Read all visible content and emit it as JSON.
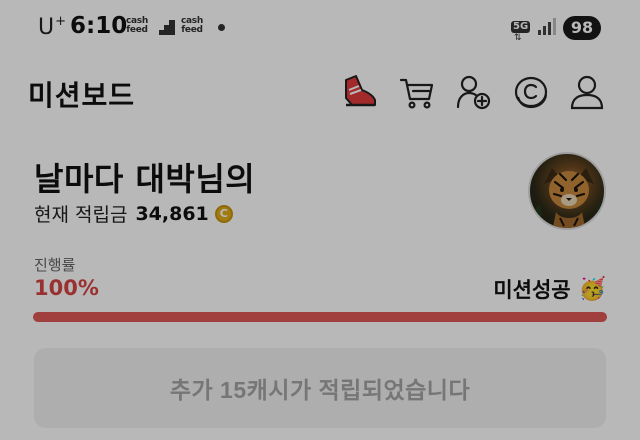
{
  "status_bar": {
    "carrier": "U",
    "carrier_mark": "+",
    "time": "6:10",
    "notification_icons": [
      {
        "name": "cashfeed-icon",
        "line1": "cash",
        "line2": "feed"
      },
      {
        "name": "stairs-app-icon"
      },
      {
        "name": "cashfeed-icon",
        "line1": "cash",
        "line2": "feed"
      }
    ],
    "network_type": "5G",
    "battery_level": "98"
  },
  "header": {
    "title": "미션보드",
    "icons": [
      "shoe-icon",
      "cart-icon",
      "add-friend-icon",
      "coin-icon",
      "profile-icon"
    ]
  },
  "profile": {
    "greeting": "날마다 대박님의",
    "points_label": "현재 적립금",
    "points_value": "34,861",
    "coin_symbol": "C"
  },
  "progress": {
    "label": "진행률",
    "value_text": "100%",
    "fraction": 1.0,
    "status_text": "미션성공",
    "status_emoji": "🥳"
  },
  "reward_button": {
    "label": "추가 15캐시가 적립되었습니다"
  },
  "colors": {
    "accent": "#d64545",
    "bar_fill": "#e05656",
    "coin": "#e0ac1b",
    "button_bg": "#f2f2f2"
  }
}
